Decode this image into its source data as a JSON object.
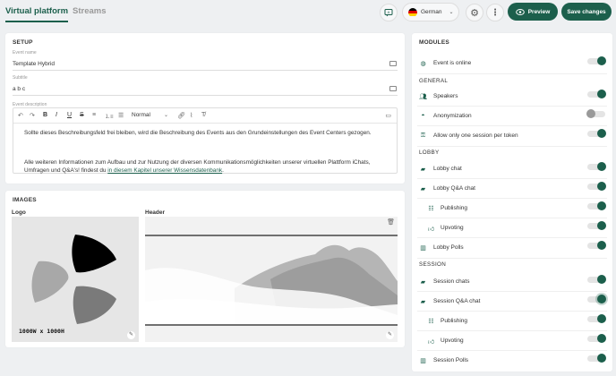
{
  "header": {
    "tabs": [
      {
        "label": "Virtual platform",
        "active": true
      },
      {
        "label": "Streams",
        "active": false
      }
    ],
    "language": "German",
    "preview_label": "Preview",
    "save_label": "Save changes",
    "accent_color": "#1c5f4c"
  },
  "setup": {
    "title": "SETUP",
    "event_name": {
      "label": "Event name",
      "value": "Template Hybrid"
    },
    "subtitle": {
      "label": "Subtitle",
      "value": "a b c"
    },
    "description": {
      "label": "Event description",
      "format_select": "Normal",
      "paragraph1": "Sollte dieses Beschreibungsfeld frei bleiben, wird die Beschreibung des Events aus den Grundeinstellungen des Event Centers gezogen.",
      "paragraph2_line1": "Alle weiteren Informationen zum Aufbau und zur Nutzung der diversen Kommunikationsmöglichkeiten unserer virtuellen Plattform iChats,",
      "paragraph2_line2_prefix": "Umfragen und Q&A's! findest du ",
      "paragraph2_link": "in diesem Kapitel unserer Wissensdatenbank",
      "paragraph2_suffix": "."
    }
  },
  "images": {
    "title": "IMAGES",
    "logo_label": "Logo",
    "header_label": "Header",
    "logo_size_text": "1000W x 1000H"
  },
  "modules": {
    "title": "MODULES",
    "rows": [
      {
        "type": "item",
        "icon": "globe-icon",
        "label": "Event is online",
        "on": true
      },
      {
        "type": "section",
        "label": "GENERAL"
      },
      {
        "type": "item",
        "icon": "people-icon",
        "label": "Speakers",
        "on": true
      },
      {
        "type": "item",
        "icon": "incognito-icon",
        "label": "Anonymization",
        "on": false
      },
      {
        "type": "item",
        "icon": "user-lock-icon",
        "label": "Allow only one session per token",
        "on": true
      },
      {
        "type": "section",
        "label": "LOBBY"
      },
      {
        "type": "item",
        "icon": "chat-icon",
        "label": "Lobby chat",
        "on": true
      },
      {
        "type": "item",
        "icon": "qa-chat-icon",
        "label": "Lobby Q&A chat",
        "on": true
      },
      {
        "type": "item",
        "icon": "publish-icon",
        "label": "Publishing",
        "on": true,
        "sub": true
      },
      {
        "type": "item",
        "icon": "thumbs-up-icon",
        "label": "Upvoting",
        "on": true,
        "sub": true
      },
      {
        "type": "item",
        "icon": "poll-icon",
        "label": "Lobby Polls",
        "on": true
      },
      {
        "type": "section",
        "label": "SESSION"
      },
      {
        "type": "item",
        "icon": "chat-icon",
        "label": "Session chats",
        "on": true
      },
      {
        "type": "item",
        "icon": "qa-chat-icon",
        "label": "Session Q&A chat",
        "on": true
      },
      {
        "type": "item",
        "icon": "publish-icon",
        "label": "Publishing",
        "on": true,
        "sub": true
      },
      {
        "type": "item",
        "icon": "thumbs-up-icon",
        "label": "Upvoting",
        "on": true,
        "sub": true
      },
      {
        "type": "item",
        "icon": "poll-icon",
        "label": "Session Polls",
        "on": true
      }
    ]
  }
}
